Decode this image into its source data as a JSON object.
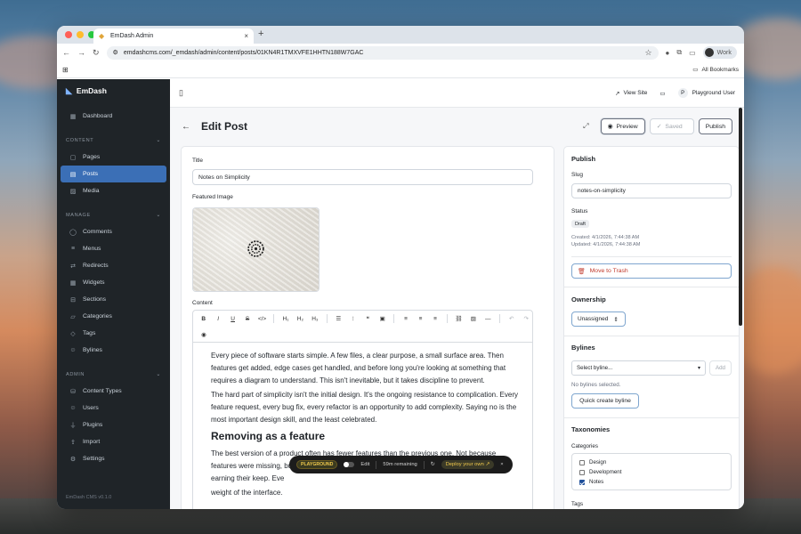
{
  "browser": {
    "tab_title": "EmDash Admin",
    "url": "emdashcms.com/_emdash/admin/content/posts/01KN4R1TMXVFE1HHTN188W7GAC",
    "profile": "Work",
    "all_bookmarks": "All Bookmarks"
  },
  "sidebar": {
    "brand": "EmDash",
    "dashboard": "Dashboard",
    "content_header": "CONTENT",
    "content_items": [
      "Pages",
      "Posts",
      "Media"
    ],
    "manage_header": "MANAGE",
    "manage_items": [
      "Comments",
      "Menus",
      "Redirects",
      "Widgets",
      "Sections",
      "Categories",
      "Tags",
      "Bylines"
    ],
    "admin_header": "ADMIN",
    "admin_items": [
      "Content Types",
      "Users",
      "Plugins",
      "Import",
      "Settings"
    ],
    "version": "EmDash CMS v0.1.0"
  },
  "topbar": {
    "view_site": "View Site",
    "user_initial": "P",
    "user_name": "Playground User"
  },
  "header": {
    "title": "Edit Post",
    "preview": "Preview",
    "saved": "Saved",
    "publish": "Publish"
  },
  "editor": {
    "title_label": "Title",
    "title_value": "Notes on Simplicity",
    "featured_label": "Featured Image",
    "content_label": "Content",
    "p1": "Every piece of software starts simple. A few files, a clear purpose, a small surface area. Then features get added, edge cases get handled, and before long you're looking at something that requires a diagram to understand. This isn't inevitable, but it takes discipline to prevent.",
    "p2": "The hard part of simplicity isn't the initial design. It's the ongoing resistance to complication. Every feature request, every bug fix, every refactor is an opportunity to add complexity. Saying no is the most important design skill, and the least celebrated.",
    "h2": "Removing as a feature",
    "p3": "The best version of a product often has fewer features than the previous one. Not because features were missing, but because someone had the courage to remove things that weren't earning their keep. Eve",
    "p3_tail": "weight of the interface."
  },
  "publish_panel": {
    "heading": "Publish",
    "slug_label": "Slug",
    "slug_value": "notes-on-simplicity",
    "status_label": "Status",
    "status_value": "Draft",
    "created": "Created: 4/1/2026, 7:44:38 AM",
    "updated": "Updated: 4/1/2026, 7:44:38 AM",
    "trash": "Move to Trash"
  },
  "ownership": {
    "heading": "Ownership",
    "value": "Unassigned"
  },
  "bylines": {
    "heading": "Bylines",
    "select_placeholder": "Select byline...",
    "add": "Add",
    "empty": "No bylines selected.",
    "quick_create": "Quick create byline"
  },
  "taxonomies": {
    "heading": "Taxonomies",
    "categories_label": "Categories",
    "categories": [
      {
        "name": "Design",
        "checked": false
      },
      {
        "name": "Development",
        "checked": false
      },
      {
        "name": "Notes",
        "checked": true
      }
    ],
    "tags_label": "Tags"
  },
  "playground": {
    "badge": "PLAYGROUND",
    "edit": "Edit",
    "remaining": "59m remaining",
    "deploy": "Deploy your own"
  },
  "colors": {
    "sidebar_bg": "#1f2428",
    "active_nav": "#3b6fb6",
    "danger": "#c0392b"
  }
}
